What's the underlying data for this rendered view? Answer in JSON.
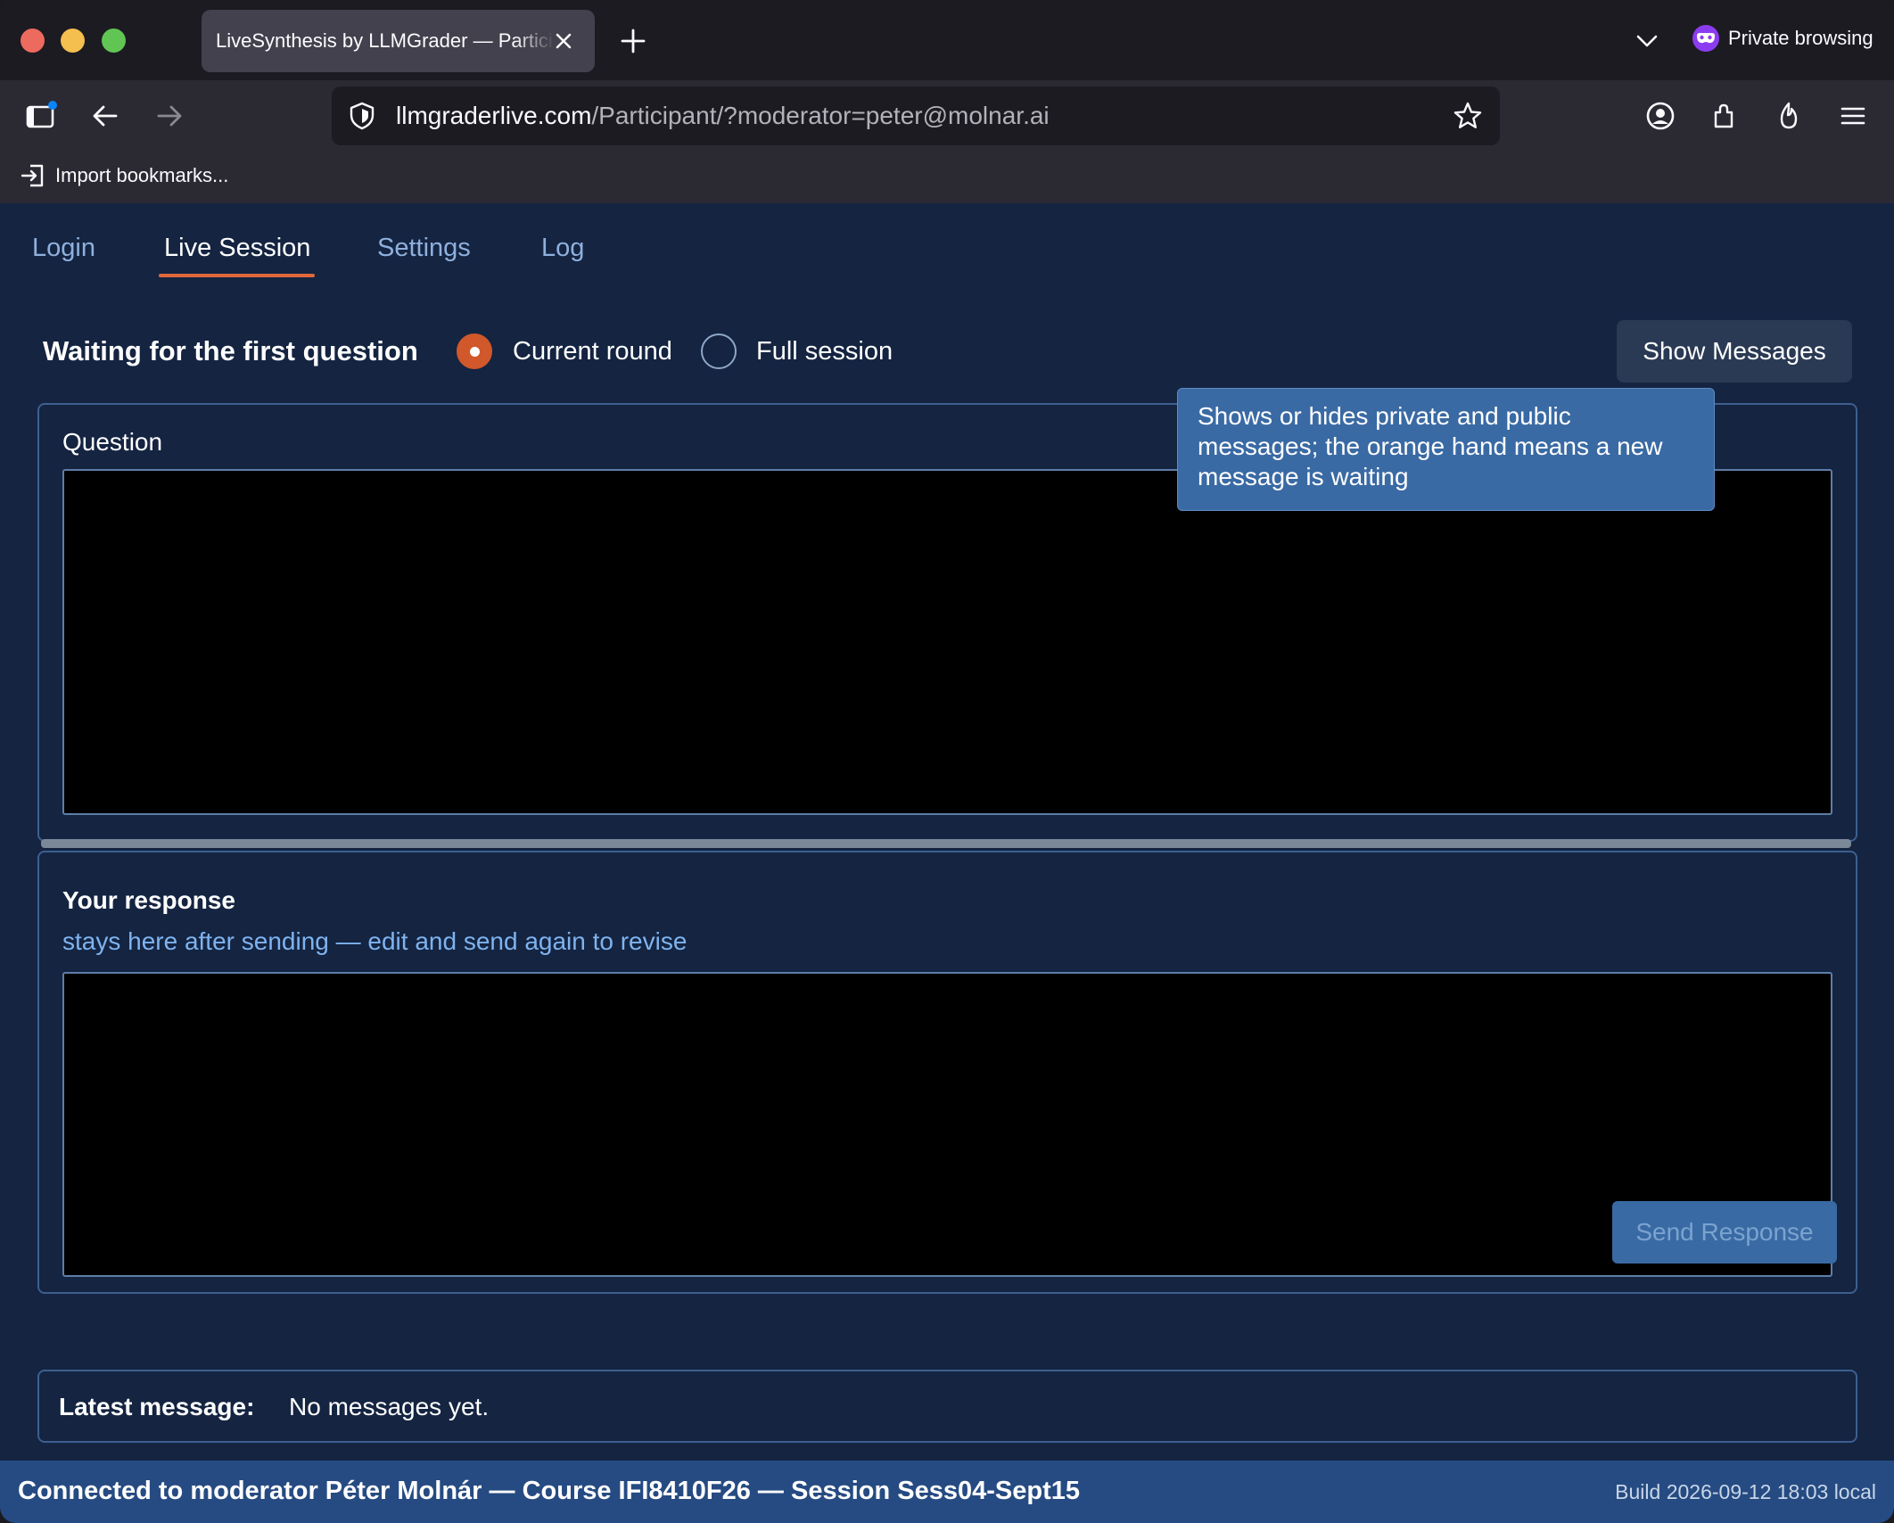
{
  "browser": {
    "tab_title": "LiveSynthesis by LLMGrader — Participant",
    "private_label": "Private browsing",
    "url_host": "llmgraderlive.com",
    "url_path": "/Participant/?moderator=peter@molnar.ai",
    "bookmark_import_label": "Import bookmarks..."
  },
  "nav": {
    "tabs": [
      "Login",
      "Live Session",
      "Settings",
      "Log"
    ],
    "active": "Live Session"
  },
  "status": {
    "title": "Waiting for the first question",
    "radio_current": "Current round",
    "radio_full": "Full session",
    "selected": "Current round",
    "show_messages_label": "Show Messages"
  },
  "tooltip": {
    "text": "Shows or hides private and public messages; the orange hand means a new message is waiting"
  },
  "question": {
    "label": "Question",
    "value": ""
  },
  "response": {
    "heading": "Your response",
    "subtitle": "stays here after sending — edit and send again to revise",
    "value": "",
    "send_label": "Send Response"
  },
  "latest": {
    "label": "Latest message:",
    "value": "No messages yet."
  },
  "statusbar": {
    "connection": "Connected to moderator Péter Molnár — Course IFI8410F26 — Session Sess04-Sept15",
    "build": "Build 2026-09-12 18:03 local"
  },
  "colors": {
    "accent": "#d0582b",
    "page_bg": "#142441",
    "panel_border": "#3d5f8f",
    "button_blue": "#3a6aa4"
  }
}
